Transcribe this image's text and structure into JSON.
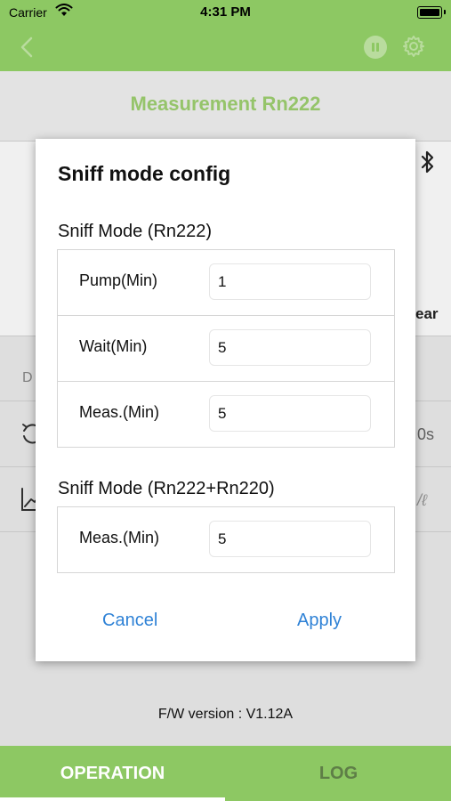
{
  "status_bar": {
    "carrier": "Carrier",
    "time": "4:31 PM"
  },
  "header": {
    "title": "Measurement Rn222"
  },
  "background": {
    "clear_fragment": "ear",
    "d_fragment": "D",
    "value_fragment_1": "0s",
    "value_fragment_2": "/ℓ"
  },
  "footer": {
    "fw_version": "F/W version : V1.12A"
  },
  "tabs": [
    {
      "label": "OPERATION",
      "active": true
    },
    {
      "label": "LOG",
      "active": false
    }
  ],
  "dialog": {
    "title": "Sniff mode config",
    "section1": {
      "label": "Sniff Mode (Rn222)",
      "rows": [
        {
          "label": "Pump(Min)",
          "value": "1"
        },
        {
          "label": "Wait(Min)",
          "value": "5"
        },
        {
          "label": "Meas.(Min)",
          "value": "5"
        }
      ]
    },
    "section2": {
      "label": "Sniff Mode (Rn222+Rn220)",
      "rows": [
        {
          "label": "Meas.(Min)",
          "value": "5"
        }
      ]
    },
    "cancel_label": "Cancel",
    "apply_label": "Apply"
  },
  "colors": {
    "primary_green": "#8dc863",
    "title_green": "#9fd171",
    "link_blue": "#2f82d6"
  },
  "icons": [
    "wifi-icon",
    "battery-icon",
    "back-chevron-icon",
    "pause-icon",
    "gear-icon",
    "bluetooth-icon",
    "history-icon",
    "chart-icon"
  ]
}
